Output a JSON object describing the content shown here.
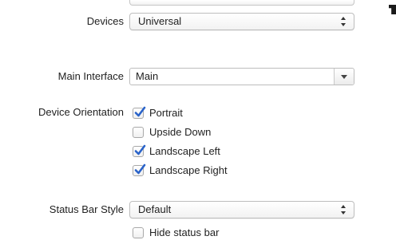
{
  "settings": {
    "devices": {
      "label": "Devices",
      "value": "Universal"
    },
    "main_interface": {
      "label": "Main Interface",
      "value": "Main"
    },
    "device_orientation": {
      "label": "Device Orientation",
      "options": [
        {
          "label": "Portrait",
          "checked": true
        },
        {
          "label": "Upside Down",
          "checked": false
        },
        {
          "label": "Landscape Left",
          "checked": true
        },
        {
          "label": "Landscape Right",
          "checked": true
        }
      ]
    },
    "status_bar_style": {
      "label": "Status Bar Style",
      "value": "Default"
    },
    "hide_status_bar": {
      "label": "Hide status bar",
      "checked": false
    }
  },
  "colors": {
    "checkmark": "#2a63c9",
    "border": "#bdbdbd",
    "text": "#222222"
  }
}
